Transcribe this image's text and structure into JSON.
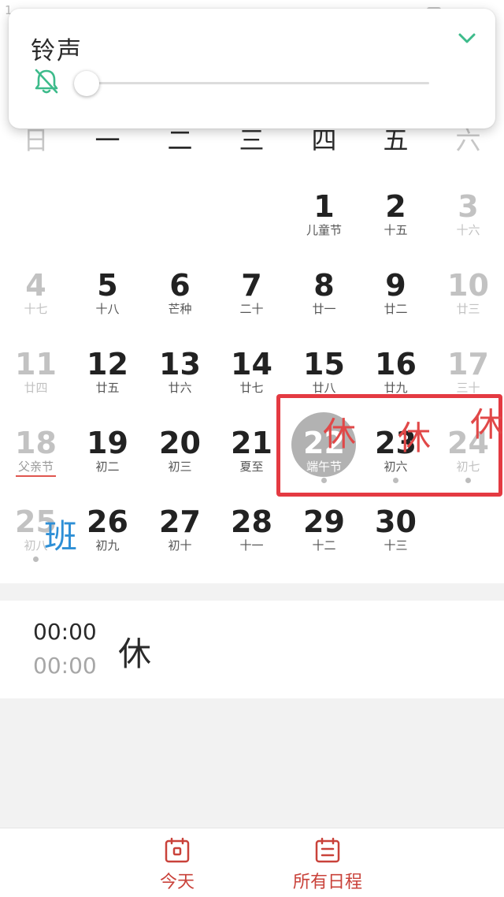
{
  "status_bar": {
    "left_text": "1...  ..."
  },
  "ringtone_popup": {
    "title": "铃声",
    "level": 0,
    "accent_color": "#3dbb8b"
  },
  "weekdays": [
    "日",
    "一",
    "二",
    "三",
    "四",
    "五",
    "六"
  ],
  "calendar": {
    "weeks": [
      [
        null,
        null,
        null,
        null,
        {
          "day": "1",
          "sub": "儿童节"
        },
        {
          "day": "2",
          "sub": "十五"
        },
        {
          "day": "3",
          "sub": "十六",
          "muted": true
        }
      ],
      [
        {
          "day": "4",
          "sub": "十七",
          "muted": true
        },
        {
          "day": "5",
          "sub": "十八"
        },
        {
          "day": "6",
          "sub": "芒种"
        },
        {
          "day": "7",
          "sub": "二十"
        },
        {
          "day": "8",
          "sub": "廿一"
        },
        {
          "day": "9",
          "sub": "廿二"
        },
        {
          "day": "10",
          "sub": "廿三",
          "muted": true
        }
      ],
      [
        {
          "day": "11",
          "sub": "廿四",
          "muted": true
        },
        {
          "day": "12",
          "sub": "廿五"
        },
        {
          "day": "13",
          "sub": "廿六"
        },
        {
          "day": "14",
          "sub": "廿七"
        },
        {
          "day": "15",
          "sub": "廿八"
        },
        {
          "day": "16",
          "sub": "廿九"
        },
        {
          "day": "17",
          "sub": "三十",
          "muted": true
        }
      ],
      [
        {
          "day": "18",
          "sub": "父亲节",
          "muted": true,
          "festival": true
        },
        {
          "day": "19",
          "sub": "初二"
        },
        {
          "day": "20",
          "sub": "初三"
        },
        {
          "day": "21",
          "sub": "夏至"
        },
        {
          "day": "22",
          "sub": "端午节",
          "selected": true,
          "dot": true
        },
        {
          "day": "23",
          "sub": "初六",
          "dot": true
        },
        {
          "day": "24",
          "sub": "初七",
          "muted": true,
          "dot": true
        }
      ],
      [
        {
          "day": "25",
          "sub": "初八",
          "muted": true,
          "dot": true
        },
        {
          "day": "26",
          "sub": "初九"
        },
        {
          "day": "27",
          "sub": "初十"
        },
        {
          "day": "28",
          "sub": "十一"
        },
        {
          "day": "29",
          "sub": "十二"
        },
        {
          "day": "30",
          "sub": "十三"
        },
        null
      ]
    ]
  },
  "overlay_marks": {
    "rest_label": "休",
    "work_label": "班",
    "rest_color": "#e14848",
    "work_color": "#2e8fd6"
  },
  "event": {
    "start_time": "00:00",
    "end_time": "00:00",
    "title": "休"
  },
  "bottom_tabs": [
    {
      "label": "今天",
      "icon": "calendar-today-icon"
    },
    {
      "label": "所有日程",
      "icon": "schedule-list-icon"
    }
  ],
  "colors": {
    "accent_red": "#c9423a",
    "highlight_box": "#e43a42",
    "selected_circle": "#b2b2b2"
  }
}
